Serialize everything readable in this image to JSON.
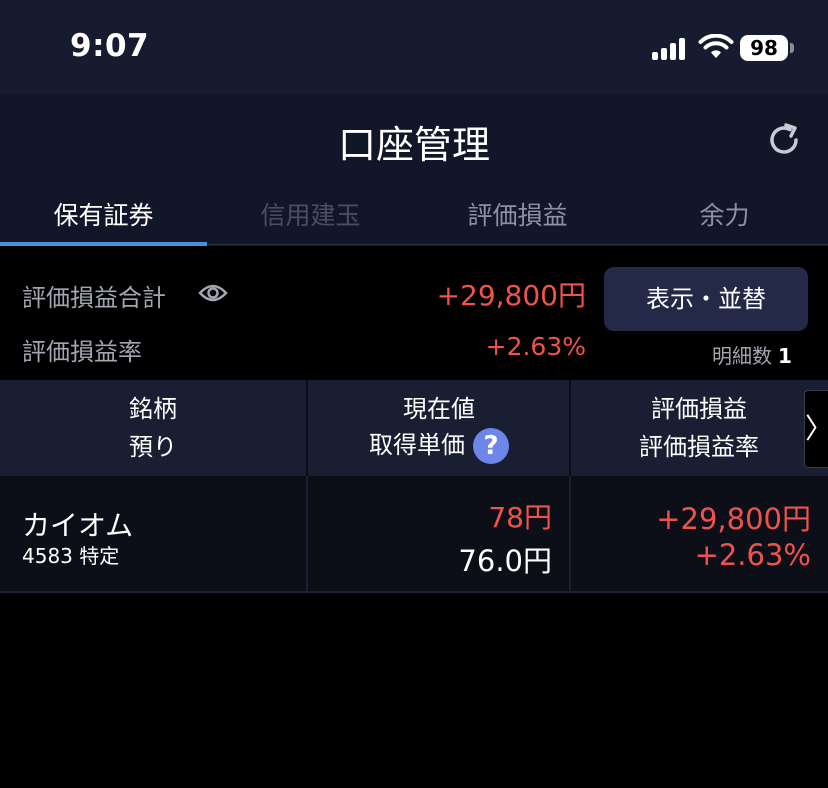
{
  "status_bar": {
    "time": "9:07",
    "battery": "98"
  },
  "header": {
    "title": "口座管理"
  },
  "tabs": [
    {
      "label": "保有証券",
      "state": "active"
    },
    {
      "label": "信用建玉",
      "state": "disabled"
    },
    {
      "label": "評価損益",
      "state": "normal"
    },
    {
      "label": "余力",
      "state": "normal"
    }
  ],
  "summary": {
    "total_label": "評価損益合計",
    "total_value": "+29,800円",
    "rate_label": "評価損益率",
    "rate_value": "+2.63%",
    "sort_button": "表示・並替",
    "detail_label": "明細数",
    "detail_count": "1"
  },
  "table": {
    "headers": {
      "col1_line1": "銘柄",
      "col1_line2": "預り",
      "col2_line1": "現在値",
      "col2_line2": "取得単価",
      "col3_line1": "評価損益",
      "col3_line2": "評価損益率"
    },
    "help_icon": "?",
    "scroll_arrow": "〉",
    "rows": [
      {
        "name": "カイオム",
        "code": "4583 特定",
        "current_price": "78円",
        "cost_price": "76.0円",
        "pl": "+29,800円",
        "pl_rate": "+2.63%"
      }
    ]
  },
  "colors": {
    "accent_red": "#f0524c",
    "tab_underline": "#4a8fd8",
    "help_icon": "#6e86e8"
  }
}
